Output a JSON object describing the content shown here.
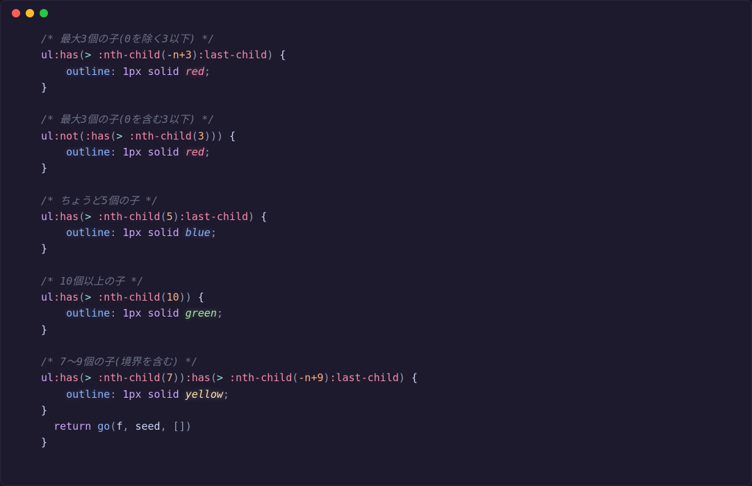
{
  "comments": {
    "c1": "/* 最大3個の子(0を除く3以下) */",
    "c2": "/* 最大3個の子(0を含む3以下) */",
    "c3": "/* ちょうど5個の子 */",
    "c4": "/* 10個以上の子 */",
    "c5": "/* 7〜9個の子(境界を含む) */"
  },
  "selectors": {
    "ul": "ul",
    "has": ":has",
    "not": ":not",
    "nthchild": ":nth-child",
    "lastchild": ":last-child"
  },
  "args": {
    "neg_n_plus_3": "-n+3",
    "three": "3",
    "five": "5",
    "ten": "10",
    "seven": "7",
    "neg_n_plus_9": "-n+9"
  },
  "decl": {
    "outline": "outline",
    "onepx_solid": "1px solid"
  },
  "colors": {
    "red": "red",
    "blue": "blue",
    "green": "green",
    "yellow": "yellow"
  },
  "tokens": {
    "open_paren": "(",
    "close_paren": ")",
    "gt": "> ",
    "open_brace": "{",
    "close_brace": "}",
    "colon": ": ",
    "semicolon": ";",
    "indent": "    ",
    "indent2": "  ",
    "space": " "
  },
  "js": {
    "return": "return",
    "go": "go",
    "f": "f",
    "seed": "seed",
    "comma_space": ", ",
    "open_bracket": "[",
    "close_bracket": "]"
  }
}
